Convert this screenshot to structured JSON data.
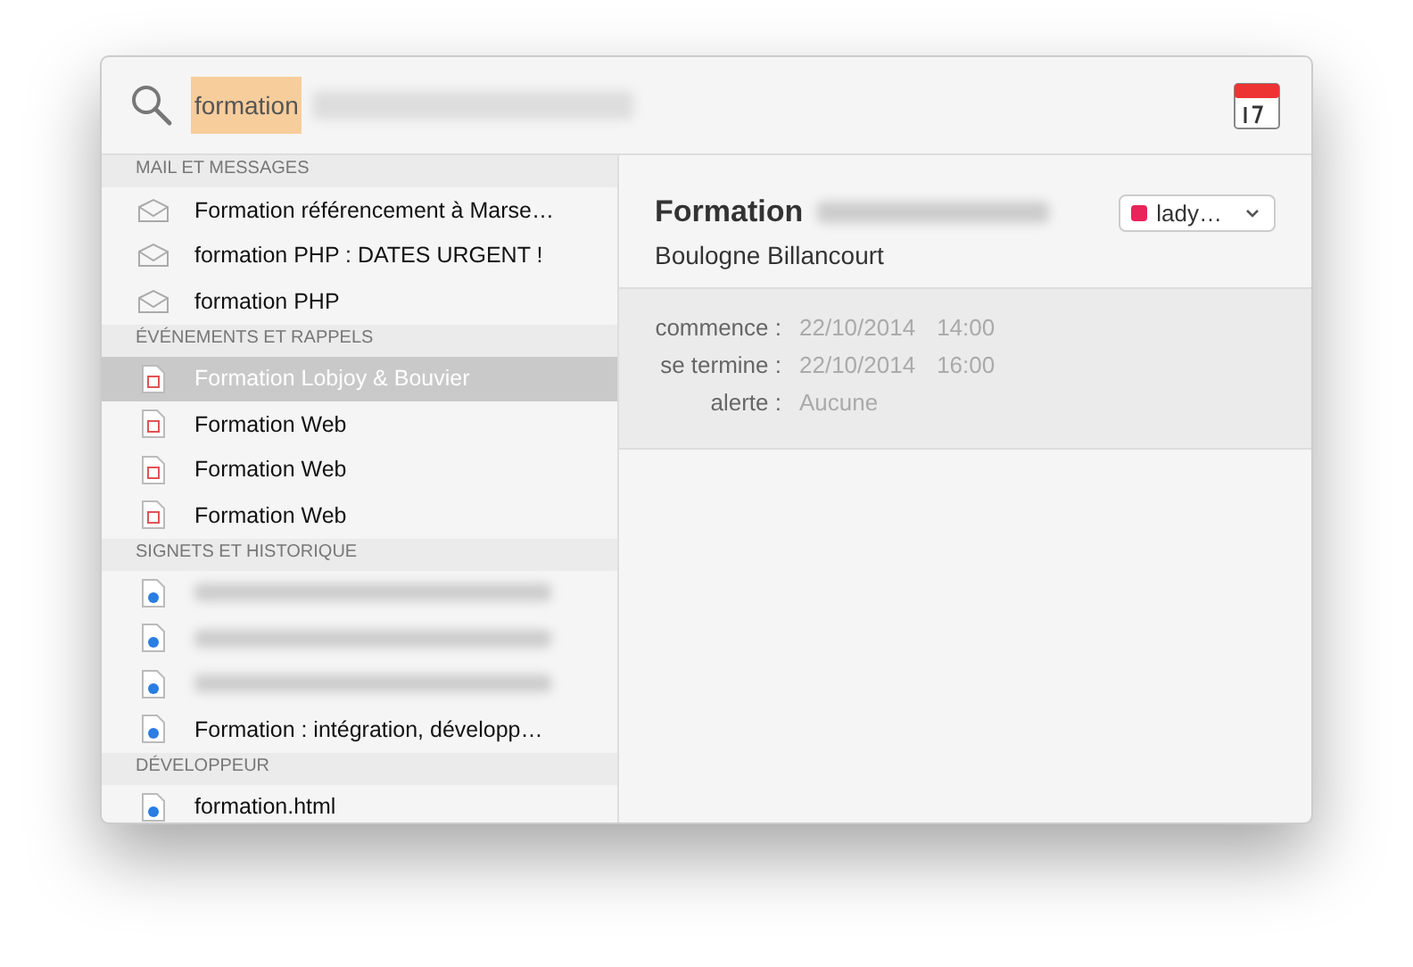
{
  "search": {
    "value": "formation",
    "value_selected": true,
    "suffix_blurred": true
  },
  "sections": [
    {
      "title": "MAIL ET MESSAGES",
      "items": [
        {
          "kind": "mail",
          "label": "Formation référencement à Marse…",
          "selected": false,
          "blurred": false
        },
        {
          "kind": "mail",
          "label": "formation PHP : DATES URGENT !",
          "selected": false,
          "blurred": false
        },
        {
          "kind": "mail",
          "label": "formation PHP",
          "selected": false,
          "blurred": false
        }
      ]
    },
    {
      "title": "ÉVÉNEMENTS ET RAPPELS",
      "items": [
        {
          "kind": "event",
          "label": "Formation Lobjoy & Bouvier",
          "selected": true,
          "blurred": false
        },
        {
          "kind": "event",
          "label": "Formation Web",
          "selected": false,
          "blurred": false
        },
        {
          "kind": "event",
          "label": "Formation Web",
          "selected": false,
          "blurred": false
        },
        {
          "kind": "event",
          "label": "Formation Web",
          "selected": false,
          "blurred": false
        }
      ]
    },
    {
      "title": "SIGNETS ET HISTORIQUE",
      "items": [
        {
          "kind": "web",
          "selected": false,
          "blurred": true
        },
        {
          "kind": "web",
          "selected": false,
          "blurred": true
        },
        {
          "kind": "web",
          "selected": false,
          "blurred": true
        },
        {
          "kind": "web",
          "label": "Formation : intégration, développ…",
          "selected": false,
          "blurred": false
        }
      ]
    },
    {
      "title": "DÉVELOPPEUR",
      "items": [
        {
          "kind": "web",
          "label": "formation.html",
          "selected": false,
          "blurred": false
        }
      ]
    }
  ],
  "detail": {
    "title": "Formation",
    "title_blurred": true,
    "location": "Boulogne Billancourt",
    "calendar": {
      "label": "lady…",
      "color": "#e8245a"
    },
    "fields": [
      {
        "label": "commence :",
        "date": "22/10/2014",
        "time": "14:00"
      },
      {
        "label": "se termine :",
        "date": "22/10/2014",
        "time": "16:00"
      },
      {
        "label": "alerte :",
        "date": "Aucune"
      }
    ]
  }
}
